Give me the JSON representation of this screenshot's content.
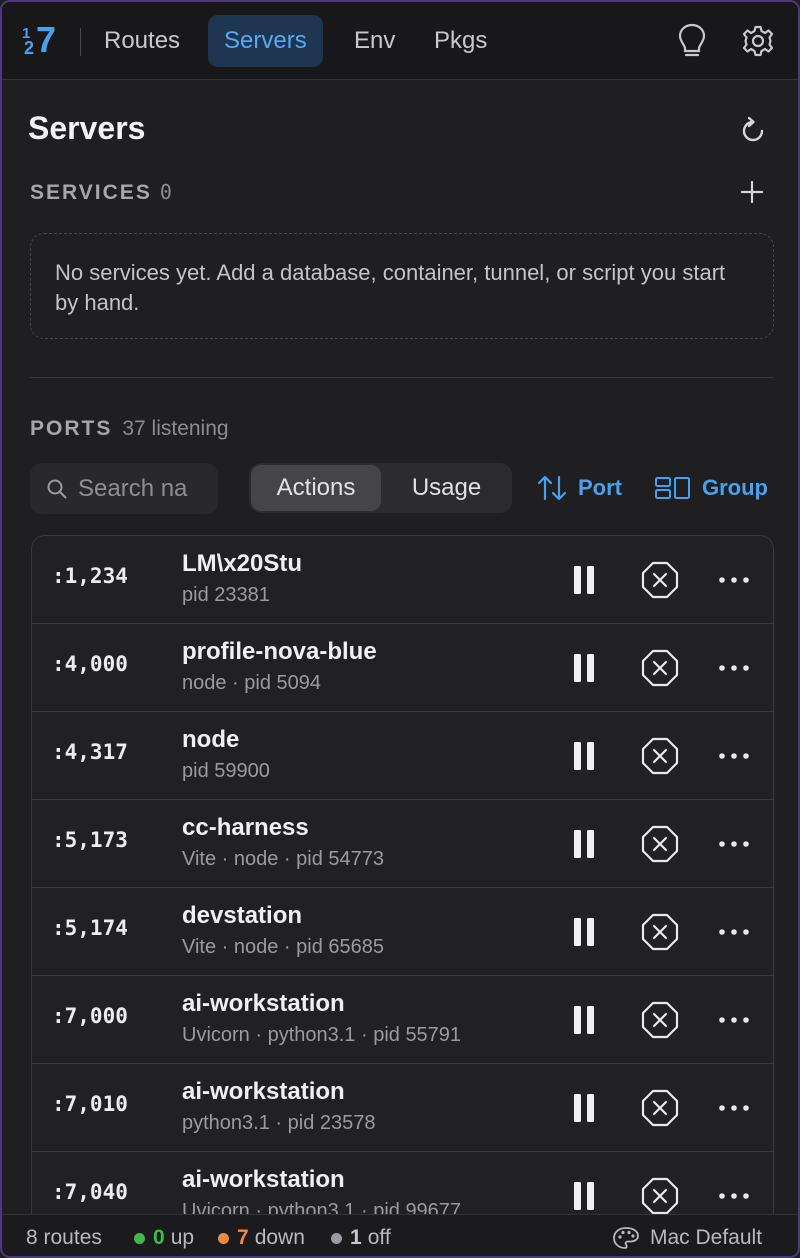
{
  "nav": {
    "logo": {
      "small_top": "1",
      "small_bottom": "2",
      "big": "7"
    },
    "tabs": [
      {
        "label": "Routes"
      },
      {
        "label": "Servers"
      },
      {
        "label": "Env"
      },
      {
        "label": "Pkgs"
      }
    ],
    "icons": [
      "lightbulb-icon",
      "gear-icon"
    ]
  },
  "header": {
    "title": "Servers"
  },
  "services": {
    "label": "SERVICES",
    "count": "0",
    "empty_text": "No services yet. Add a database, container, tunnel, or script you start by hand."
  },
  "ports": {
    "label": "PORTS",
    "count_text": "37 listening"
  },
  "toolbar": {
    "search_placeholder": "Search na",
    "segments": [
      {
        "label": "Actions"
      },
      {
        "label": "Usage"
      }
    ],
    "sort_label": "Port",
    "group_label": "Group"
  },
  "rows": [
    {
      "port": ":1,234",
      "name": "LM\\x20Stu",
      "meta": "pid 23381"
    },
    {
      "port": ":4,000",
      "name": "profile-nova-blue",
      "meta": "node · pid 5094"
    },
    {
      "port": ":4,317",
      "name": "node",
      "meta": "pid 59900"
    },
    {
      "port": ":5,173",
      "name": "cc-harness",
      "meta": "Vite · node · pid 54773"
    },
    {
      "port": ":5,174",
      "name": "devstation",
      "meta": "Vite · node · pid 65685"
    },
    {
      "port": ":7,000",
      "name": "ai-workstation",
      "meta": "Uvicorn · python3.1 · pid 55791"
    },
    {
      "port": ":7,010",
      "name": "ai-workstation",
      "meta": "python3.1 · pid 23578"
    },
    {
      "port": ":7,040",
      "name": "ai-workstation",
      "meta": "Uvicorn · python3.1 · pid 99677"
    }
  ],
  "footer": {
    "routes": "8 routes",
    "up_count": "0",
    "up_label": "up",
    "down_count": "7",
    "down_label": "down",
    "off_count": "1",
    "off_label": "off",
    "theme": "Mac Default"
  },
  "colors": {
    "accent": "#4aa0f0",
    "up": "#3fb950",
    "down": "#f0883e",
    "off": "#9a9aa0"
  }
}
